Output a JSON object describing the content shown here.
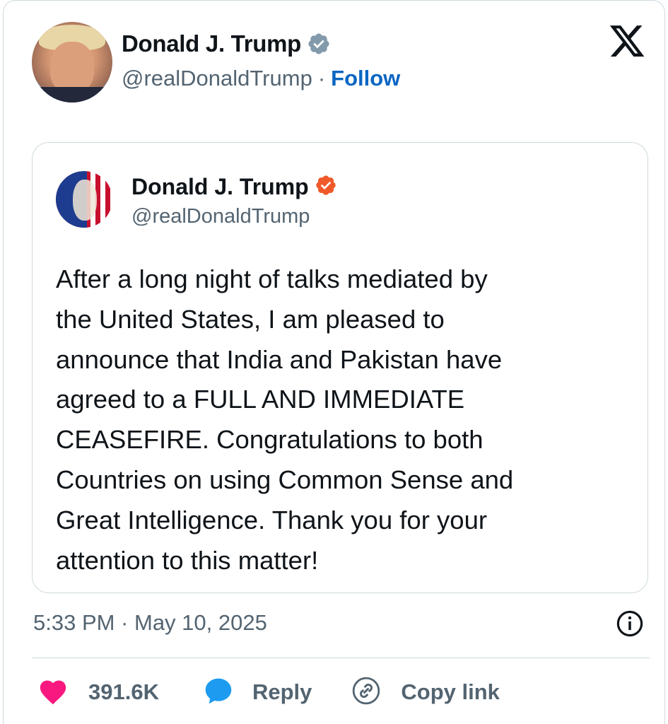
{
  "author": {
    "display_name": "Donald J. Trump",
    "handle": "@realDonaldTrump",
    "separator": "·",
    "follow_label": "Follow"
  },
  "quoted_post": {
    "display_name": "Donald J. Trump",
    "handle": "@realDonaldTrump",
    "text": "After a long night of talks mediated by\nthe United States, I am pleased to\nannounce that India and Pakistan have\nagreed to a FULL AND IMMEDIATE\nCEASEFIRE. Congratulations to both\nCountries on using Common Sense and\nGreat Intelligence. Thank you for your\nattention to this matter!"
  },
  "meta": {
    "timestamp": "5:33 PM · May 10, 2025"
  },
  "actions": {
    "like_count": "391.6K",
    "reply_label": "Reply",
    "copy_link_label": "Copy link"
  },
  "colors": {
    "accent_link": "#0a66c2",
    "verified_gray": "#829aab",
    "verified_orange": "#f0592a",
    "like_pink": "#f91880",
    "reply_blue": "#1d9bf0",
    "secondary_text": "#536471"
  },
  "icons": {
    "brand": "x-logo-icon",
    "verified_main": "verified-badge-gray-icon",
    "verified_quote": "verified-badge-orange-icon",
    "info": "info-icon",
    "like": "heart-icon",
    "reply": "speech-bubble-icon",
    "copy": "link-icon"
  }
}
